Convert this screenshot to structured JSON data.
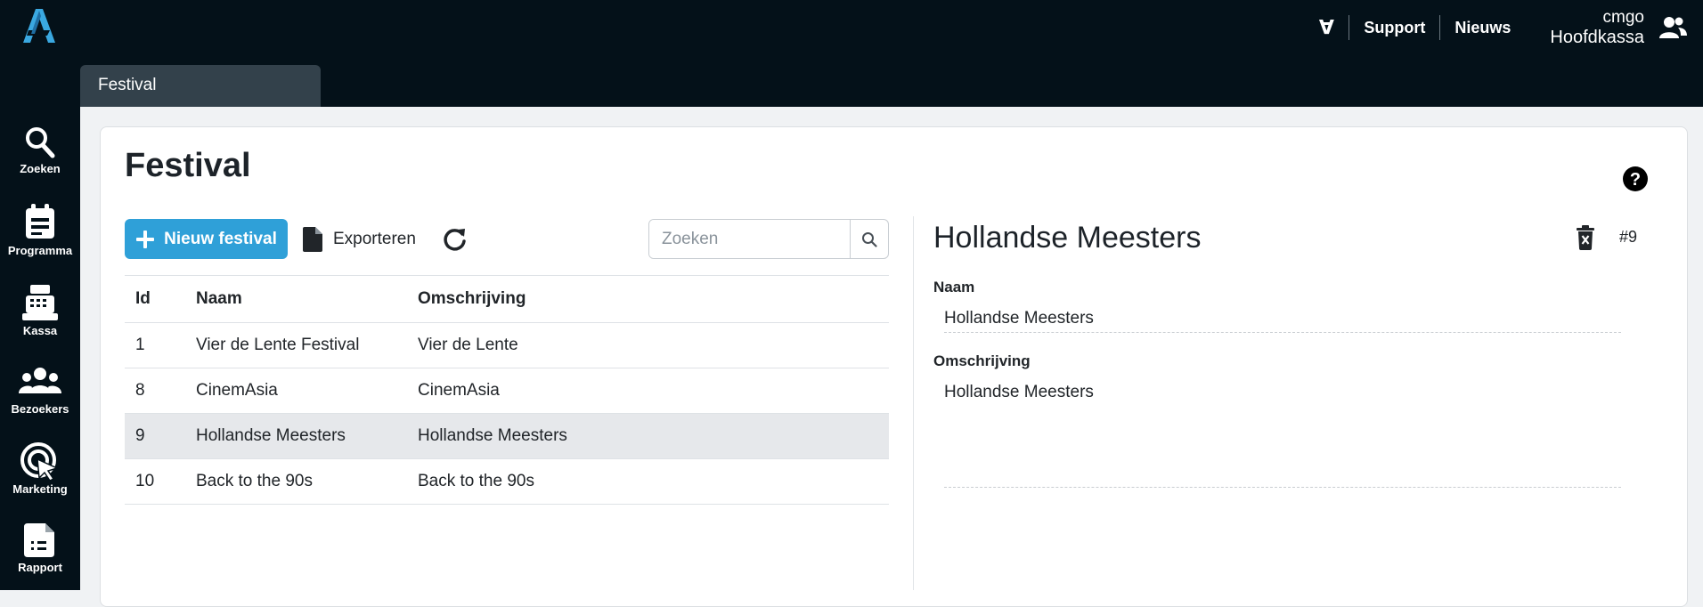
{
  "topbar": {
    "filter_symbol": "∀",
    "support": "Support",
    "news": "Nieuws",
    "user_name": "cmgo",
    "user_store": "Hoofdkassa"
  },
  "tab": {
    "label": "Festival"
  },
  "sidebar": {
    "items": [
      {
        "label": "Zoeken",
        "icon": "search-icon"
      },
      {
        "label": "Programma",
        "icon": "calendar-icon"
      },
      {
        "label": "Kassa",
        "icon": "cash-register-icon"
      },
      {
        "label": "Bezoekers",
        "icon": "users-icon"
      },
      {
        "label": "Marketing",
        "icon": "target-icon"
      },
      {
        "label": "Rapport",
        "icon": "report-icon"
      }
    ]
  },
  "page": {
    "title": "Festival"
  },
  "toolbar": {
    "new_label": "Nieuw festival",
    "export_label": "Exporteren",
    "search_placeholder": "Zoeken"
  },
  "table": {
    "headers": [
      "Id",
      "Naam",
      "Omschrijving"
    ],
    "rows": [
      {
        "id": "1",
        "naam": "Vier de Lente Festival",
        "omschrijving": "Vier de Lente"
      },
      {
        "id": "8",
        "naam": "CinemAsia",
        "omschrijving": "CinemAsia"
      },
      {
        "id": "9",
        "naam": "Hollandse Meesters",
        "omschrijving": "Hollandse Meesters"
      },
      {
        "id": "10",
        "naam": "Back to the 90s",
        "omschrijving": "Back to the 90s"
      }
    ],
    "selected_index": 2
  },
  "detail": {
    "title": "Hollandse Meesters",
    "id_label": "#9",
    "naam_label": "Naam",
    "naam_value": "Hollandse Meesters",
    "omschrijving_label": "Omschrijving",
    "omschrijving_value": "Hollandse Meesters"
  },
  "colors": {
    "dark_bg": "#041119",
    "tab_bg": "#33414b",
    "accent": "#2fa0d8",
    "logo": "#3aa8e0",
    "selected_row": "#e6e8eb"
  }
}
